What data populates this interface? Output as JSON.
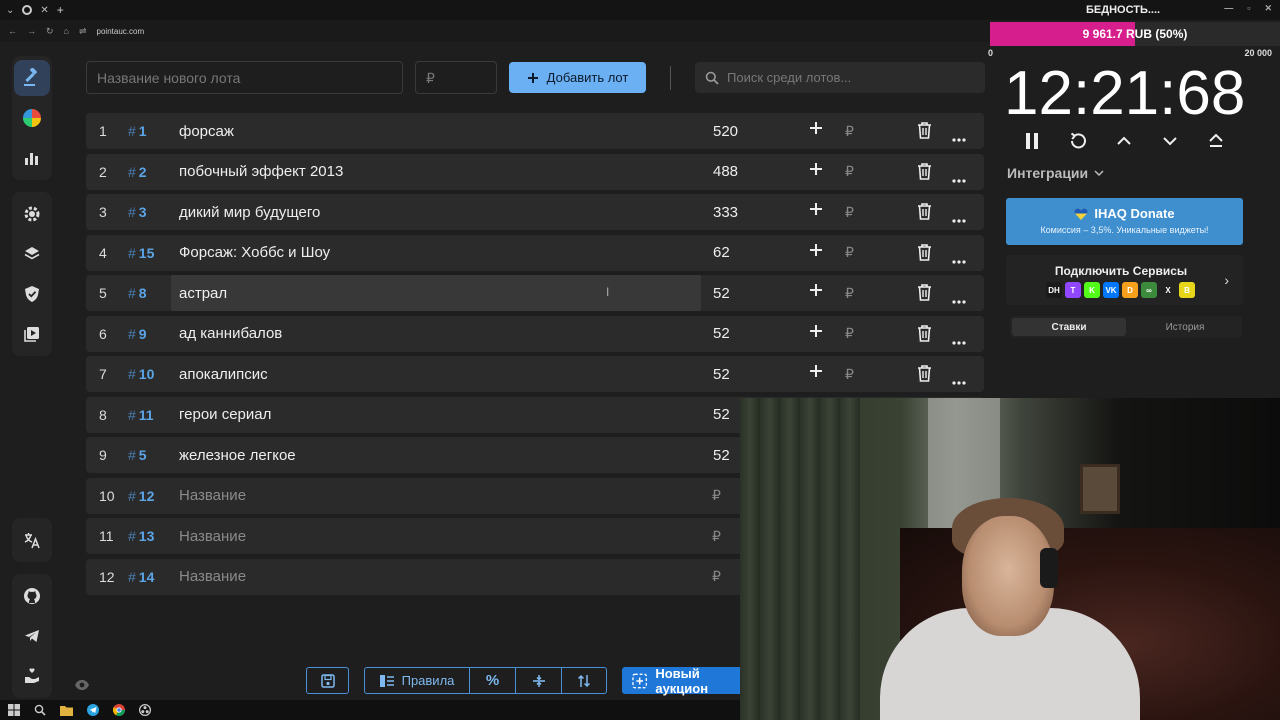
{
  "browser": {
    "url": "pointauc.com",
    "window_title": "БЕДНОСТЬ...."
  },
  "toolbar": {
    "name_placeholder": "Название нового лота",
    "price_placeholder": "₽",
    "add_button_label": "Добавить лот",
    "search_placeholder": "Поиск среди лотов..."
  },
  "lots": [
    {
      "index": "1",
      "id": "1",
      "name": "форсаж",
      "amount": "520"
    },
    {
      "index": "2",
      "id": "2",
      "name": "побочный эффект 2013",
      "amount": "488"
    },
    {
      "index": "3",
      "id": "3",
      "name": "дикий мир будущего",
      "amount": "333"
    },
    {
      "index": "4",
      "id": "15",
      "name": "Форсаж: Хоббс и Шоу",
      "amount": "62"
    },
    {
      "index": "5",
      "id": "8",
      "name": "астрал",
      "amount": "52"
    },
    {
      "index": "6",
      "id": "9",
      "name": "ад каннибалов",
      "amount": "52"
    },
    {
      "index": "7",
      "id": "10",
      "name": "апокалипсис",
      "amount": "52"
    },
    {
      "index": "8",
      "id": "11",
      "name": "герои сериал",
      "amount": "52"
    },
    {
      "index": "9",
      "id": "5",
      "name": "железное легкое",
      "amount": "52"
    },
    {
      "index": "10",
      "id": "12",
      "name": "Название",
      "amount": ""
    },
    {
      "index": "11",
      "id": "13",
      "name": "Название",
      "amount": ""
    },
    {
      "index": "12",
      "id": "14",
      "name": "Название",
      "amount": ""
    }
  ],
  "hash_symbol": "#",
  "currency_symbol": "₽",
  "bottom_toolbar": {
    "rules_label": "Правила",
    "new_auction_label": "Новый аукцион"
  },
  "right_panel": {
    "progress_label": "9 961.7 RUB (50%)",
    "progress_fraction": 0.5,
    "progress_min": "0",
    "progress_max": "20 000",
    "timer": "12:21:68",
    "integrations_label": "Интеграции",
    "donate_title": "IHAQ Donate",
    "donate_subtitle": "Комиссия – 3,5%. Уникальные виджеты!",
    "connect_title": "Подключить Сервисы",
    "tab_bids": "Ставки",
    "tab_history": "История"
  },
  "services": [
    {
      "name": "donationhub",
      "label": "DH",
      "color": "#1a1a1a"
    },
    {
      "name": "twitch",
      "label": "T",
      "color": "#9146ff"
    },
    {
      "name": "kick",
      "label": "K",
      "color": "#53fc18"
    },
    {
      "name": "vk",
      "label": "VK",
      "color": "#0077ff"
    },
    {
      "name": "donatepay",
      "label": "D",
      "color": "#f7a01c"
    },
    {
      "name": "link",
      "label": "∞",
      "color": "#3c8a3c"
    },
    {
      "name": "x",
      "label": "X",
      "color": "#222222"
    },
    {
      "name": "boosty",
      "label": "B",
      "color": "#e5d61a"
    }
  ],
  "colors": {
    "accent": "#6ab0f3",
    "id_blue": "#5ba4e6",
    "progress": "#d61f8c",
    "donate": "#3f8fcf",
    "new_auction": "#1f78d8"
  }
}
